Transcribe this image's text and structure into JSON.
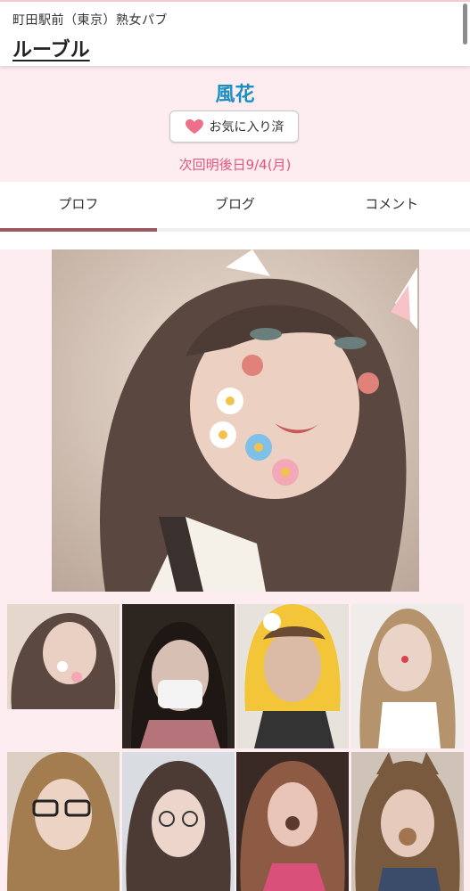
{
  "header": {
    "area_label": "町田駅前（東京）熟女パブ",
    "shop_name": "ルーブル"
  },
  "profile": {
    "name": "風花",
    "favorite_button": {
      "icon": "heart-icon",
      "label": "お気に入り済"
    },
    "next_shift": "次回明後日9/4(月)"
  },
  "tabs": [
    {
      "label": "プロフ",
      "active": true
    },
    {
      "label": "ブログ",
      "active": false
    },
    {
      "label": "コメント",
      "active": false
    }
  ],
  "colors": {
    "accent_pink_bg": "#fdecf0",
    "name_blue": "#1c8fc0",
    "shift_pink": "#e0577a",
    "tab_indicator": "#9b5a62",
    "heart_pink": "#ee6f8a"
  }
}
